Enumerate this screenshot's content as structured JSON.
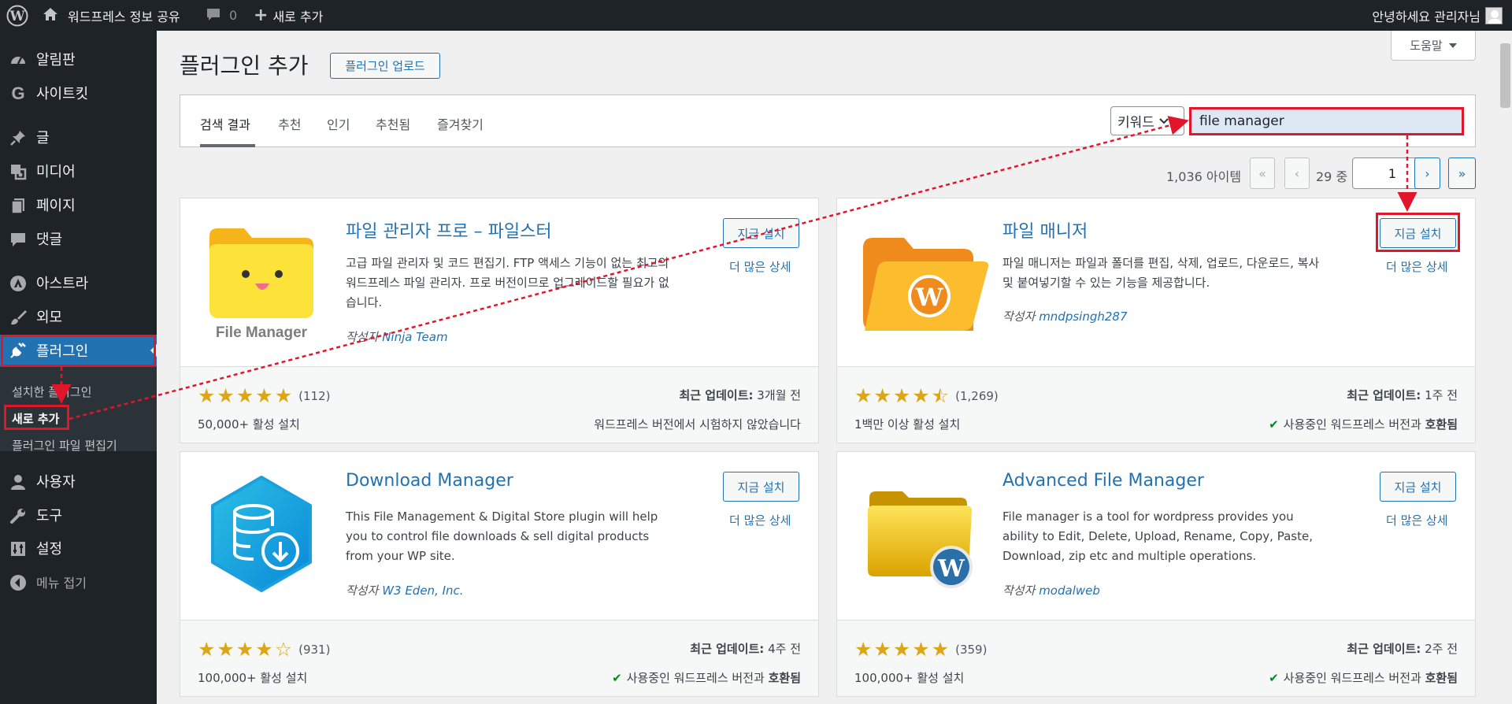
{
  "adminbar": {
    "site_name": "워드프레스 정보 공유",
    "comments_count": "0",
    "new_label": "새로 추가",
    "greeting": "안녕하세요 관리자님"
  },
  "sidebar": {
    "items": [
      {
        "label": "알림판",
        "icon": "dashboard-icon"
      },
      {
        "label": "사이트킷",
        "icon": "google-icon"
      },
      {
        "label": "글",
        "icon": "pin-icon"
      },
      {
        "label": "미디어",
        "icon": "media-icon"
      },
      {
        "label": "페이지",
        "icon": "page-icon"
      },
      {
        "label": "댓글",
        "icon": "comment-icon"
      },
      {
        "label": "아스트라",
        "icon": "astra-icon"
      },
      {
        "label": "외모",
        "icon": "brush-icon"
      },
      {
        "label": "플러그인",
        "icon": "plugin-icon"
      },
      {
        "label": "사용자",
        "icon": "user-icon"
      },
      {
        "label": "도구",
        "icon": "wrench-icon"
      },
      {
        "label": "설정",
        "icon": "settings-icon"
      },
      {
        "label": "메뉴 접기",
        "icon": "collapse-icon"
      }
    ],
    "submenu": [
      "설치한 플러그인",
      "새로 추가",
      "플러그인 파일 편집기"
    ]
  },
  "page": {
    "title": "플러그인 추가",
    "upload_btn": "플러그인 업로드",
    "help": "도움말"
  },
  "filter": {
    "tabs": [
      "검색 결과",
      "추천",
      "인기",
      "추천됨",
      "즐겨찾기"
    ],
    "type_select": "키워드",
    "search_value": "file manager"
  },
  "pagination": {
    "items": "1,036 아이템",
    "first": "«",
    "prev": "‹",
    "of": "29 중",
    "current": "1",
    "next": "›",
    "last": "»"
  },
  "plugins": [
    {
      "name": "파일 관리자 프로 – 파일스터",
      "desc": "고급 파일 관리자 및 코드 편집기. FTP 액세스 기능이 없는 최고의 워드프레스 파일 관리자. 프로 버전이므로 업그레이드할 필요가 없습니다.",
      "author_prefix": "작성자",
      "author": "Ninja Team",
      "install": "지금 설치",
      "more": "더 많은 상세",
      "rating": 5.0,
      "rating_count": "(112)",
      "installs": "50,000+ 활성 설치",
      "updated_label": "최근 업데이트:",
      "updated": "3개월 전",
      "compat": "워드프레스 버전에서 시험하지 않았습니다",
      "compat_ok": false,
      "logo_text": "File Manager"
    },
    {
      "name": "파일 매니저",
      "desc": "파일 매니저는 파일과 폴더를 편집, 삭제, 업로드, 다운로드, 복사 및 붙여넣기할 수 있는 기능을 제공합니다.",
      "author_prefix": "작성자",
      "author": "mndpsingh287",
      "install": "지금 설치",
      "more": "더 많은 상세",
      "rating": 4.5,
      "rating_count": "(1,269)",
      "installs": "1백만 이상 활성 설치",
      "updated_label": "최근 업데이트:",
      "updated": "1주 전",
      "compat_prefix": "사용중인 워드프레스 버전과",
      "compat_strong": "호환됨",
      "compat_ok": true
    },
    {
      "name": "Download Manager",
      "desc": "This File Management & Digital Store plugin will help you to control file downloads & sell digital products from your WP site.",
      "author_prefix": "작성자",
      "author": "W3 Eden, Inc.",
      "install": "지금 설치",
      "more": "더 많은 상세",
      "rating": 4.0,
      "rating_count": "(931)",
      "installs": "100,000+ 활성 설치",
      "updated_label": "최근 업데이트:",
      "updated": "4주 전",
      "compat_prefix": "사용중인 워드프레스 버전과",
      "compat_strong": "호환됨",
      "compat_ok": true
    },
    {
      "name": "Advanced File Manager",
      "desc": "File manager is a tool for wordpress provides you ability to Edit, Delete, Upload, Rename, Copy, Paste, Download, zip etc and multiple operations.",
      "author_prefix": "작성자",
      "author": "modalweb",
      "install": "지금 설치",
      "more": "더 많은 상세",
      "rating": 5.0,
      "rating_count": "(359)",
      "installs": "100,000+ 활성 설치",
      "updated_label": "최근 업데이트:",
      "updated": "2주 전",
      "compat_prefix": "사용중인 워드프레스 버전과",
      "compat_strong": "호환됨",
      "compat_ok": true
    }
  ],
  "colors": {
    "accent": "#2271b1",
    "annotation_red": "#e2162a",
    "star": "#dba617",
    "admin_bg": "#1d2327"
  }
}
